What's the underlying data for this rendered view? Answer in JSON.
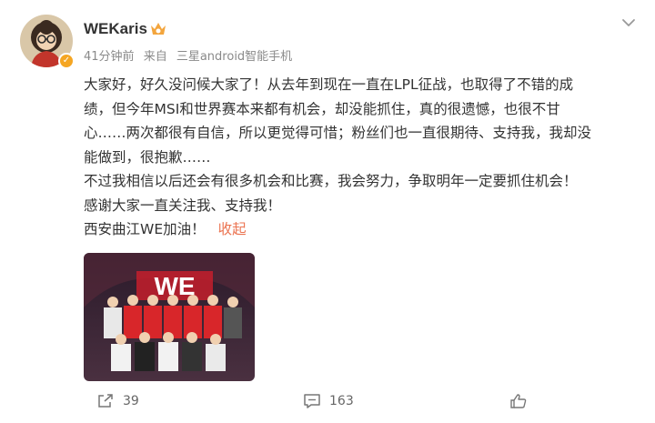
{
  "user": {
    "name": "WEKaris"
  },
  "meta": {
    "time": "41分钟前",
    "from_label": "来自",
    "source": "三星android智能手机"
  },
  "post": {
    "lines": [
      "大家好，好久没问候大家了！从去年到现在一直在LPL征战，也取得了不错的成",
      "绩，但今年MSI和世界赛本来都有机会，却没能抓住，真的很遗憾，也很不甘",
      "心……两次都很有自信，所以更觉得可惜；粉丝们也一直很期待、支持我，我却没",
      "能做到，很抱歉……",
      "不过我相信以后还会有很多机会和比赛，我会努力，争取明年一定要抓住机会！",
      "感谢大家一直关注我、支持我！",
      "西安曲江WE加油！"
    ],
    "collapse_label": "收起"
  },
  "actions": {
    "repost_count": "39",
    "comment_count": "163"
  },
  "colors": {
    "accent": "#eb7350",
    "meta": "#8a8a8a",
    "text": "#333333",
    "team_red": "#d8262a"
  },
  "icons": [
    "chevron-down-icon",
    "verified-icon",
    "vip-badge-icon",
    "repost-icon",
    "comment-icon",
    "like-icon"
  ]
}
